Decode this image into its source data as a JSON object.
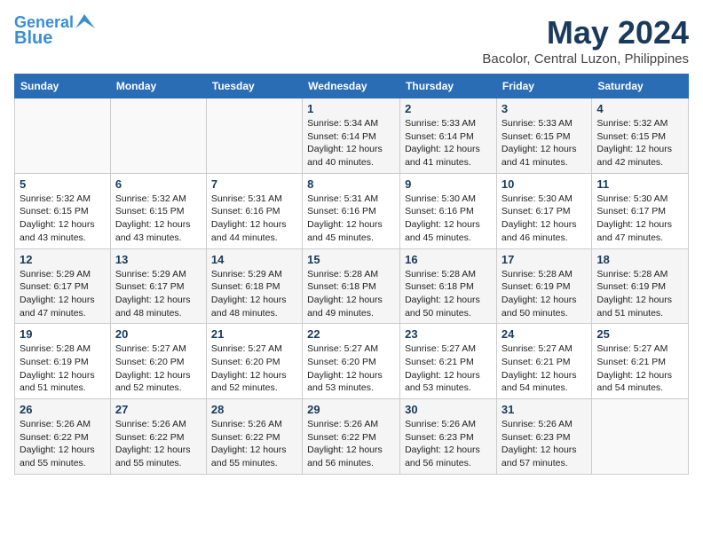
{
  "header": {
    "logo_line1": "General",
    "logo_line2": "Blue",
    "month_title": "May 2024",
    "location": "Bacolor, Central Luzon, Philippines"
  },
  "weekdays": [
    "Sunday",
    "Monday",
    "Tuesday",
    "Wednesday",
    "Thursday",
    "Friday",
    "Saturday"
  ],
  "weeks": [
    [
      {
        "day": "",
        "info": ""
      },
      {
        "day": "",
        "info": ""
      },
      {
        "day": "",
        "info": ""
      },
      {
        "day": "1",
        "info": "Sunrise: 5:34 AM\nSunset: 6:14 PM\nDaylight: 12 hours\nand 40 minutes."
      },
      {
        "day": "2",
        "info": "Sunrise: 5:33 AM\nSunset: 6:14 PM\nDaylight: 12 hours\nand 41 minutes."
      },
      {
        "day": "3",
        "info": "Sunrise: 5:33 AM\nSunset: 6:15 PM\nDaylight: 12 hours\nand 41 minutes."
      },
      {
        "day": "4",
        "info": "Sunrise: 5:32 AM\nSunset: 6:15 PM\nDaylight: 12 hours\nand 42 minutes."
      }
    ],
    [
      {
        "day": "5",
        "info": "Sunrise: 5:32 AM\nSunset: 6:15 PM\nDaylight: 12 hours\nand 43 minutes."
      },
      {
        "day": "6",
        "info": "Sunrise: 5:32 AM\nSunset: 6:15 PM\nDaylight: 12 hours\nand 43 minutes."
      },
      {
        "day": "7",
        "info": "Sunrise: 5:31 AM\nSunset: 6:16 PM\nDaylight: 12 hours\nand 44 minutes."
      },
      {
        "day": "8",
        "info": "Sunrise: 5:31 AM\nSunset: 6:16 PM\nDaylight: 12 hours\nand 45 minutes."
      },
      {
        "day": "9",
        "info": "Sunrise: 5:30 AM\nSunset: 6:16 PM\nDaylight: 12 hours\nand 45 minutes."
      },
      {
        "day": "10",
        "info": "Sunrise: 5:30 AM\nSunset: 6:17 PM\nDaylight: 12 hours\nand 46 minutes."
      },
      {
        "day": "11",
        "info": "Sunrise: 5:30 AM\nSunset: 6:17 PM\nDaylight: 12 hours\nand 47 minutes."
      }
    ],
    [
      {
        "day": "12",
        "info": "Sunrise: 5:29 AM\nSunset: 6:17 PM\nDaylight: 12 hours\nand 47 minutes."
      },
      {
        "day": "13",
        "info": "Sunrise: 5:29 AM\nSunset: 6:17 PM\nDaylight: 12 hours\nand 48 minutes."
      },
      {
        "day": "14",
        "info": "Sunrise: 5:29 AM\nSunset: 6:18 PM\nDaylight: 12 hours\nand 48 minutes."
      },
      {
        "day": "15",
        "info": "Sunrise: 5:28 AM\nSunset: 6:18 PM\nDaylight: 12 hours\nand 49 minutes."
      },
      {
        "day": "16",
        "info": "Sunrise: 5:28 AM\nSunset: 6:18 PM\nDaylight: 12 hours\nand 50 minutes."
      },
      {
        "day": "17",
        "info": "Sunrise: 5:28 AM\nSunset: 6:19 PM\nDaylight: 12 hours\nand 50 minutes."
      },
      {
        "day": "18",
        "info": "Sunrise: 5:28 AM\nSunset: 6:19 PM\nDaylight: 12 hours\nand 51 minutes."
      }
    ],
    [
      {
        "day": "19",
        "info": "Sunrise: 5:28 AM\nSunset: 6:19 PM\nDaylight: 12 hours\nand 51 minutes."
      },
      {
        "day": "20",
        "info": "Sunrise: 5:27 AM\nSunset: 6:20 PM\nDaylight: 12 hours\nand 52 minutes."
      },
      {
        "day": "21",
        "info": "Sunrise: 5:27 AM\nSunset: 6:20 PM\nDaylight: 12 hours\nand 52 minutes."
      },
      {
        "day": "22",
        "info": "Sunrise: 5:27 AM\nSunset: 6:20 PM\nDaylight: 12 hours\nand 53 minutes."
      },
      {
        "day": "23",
        "info": "Sunrise: 5:27 AM\nSunset: 6:21 PM\nDaylight: 12 hours\nand 53 minutes."
      },
      {
        "day": "24",
        "info": "Sunrise: 5:27 AM\nSunset: 6:21 PM\nDaylight: 12 hours\nand 54 minutes."
      },
      {
        "day": "25",
        "info": "Sunrise: 5:27 AM\nSunset: 6:21 PM\nDaylight: 12 hours\nand 54 minutes."
      }
    ],
    [
      {
        "day": "26",
        "info": "Sunrise: 5:26 AM\nSunset: 6:22 PM\nDaylight: 12 hours\nand 55 minutes."
      },
      {
        "day": "27",
        "info": "Sunrise: 5:26 AM\nSunset: 6:22 PM\nDaylight: 12 hours\nand 55 minutes."
      },
      {
        "day": "28",
        "info": "Sunrise: 5:26 AM\nSunset: 6:22 PM\nDaylight: 12 hours\nand 55 minutes."
      },
      {
        "day": "29",
        "info": "Sunrise: 5:26 AM\nSunset: 6:22 PM\nDaylight: 12 hours\nand 56 minutes."
      },
      {
        "day": "30",
        "info": "Sunrise: 5:26 AM\nSunset: 6:23 PM\nDaylight: 12 hours\nand 56 minutes."
      },
      {
        "day": "31",
        "info": "Sunrise: 5:26 AM\nSunset: 6:23 PM\nDaylight: 12 hours\nand 57 minutes."
      },
      {
        "day": "",
        "info": ""
      }
    ]
  ]
}
